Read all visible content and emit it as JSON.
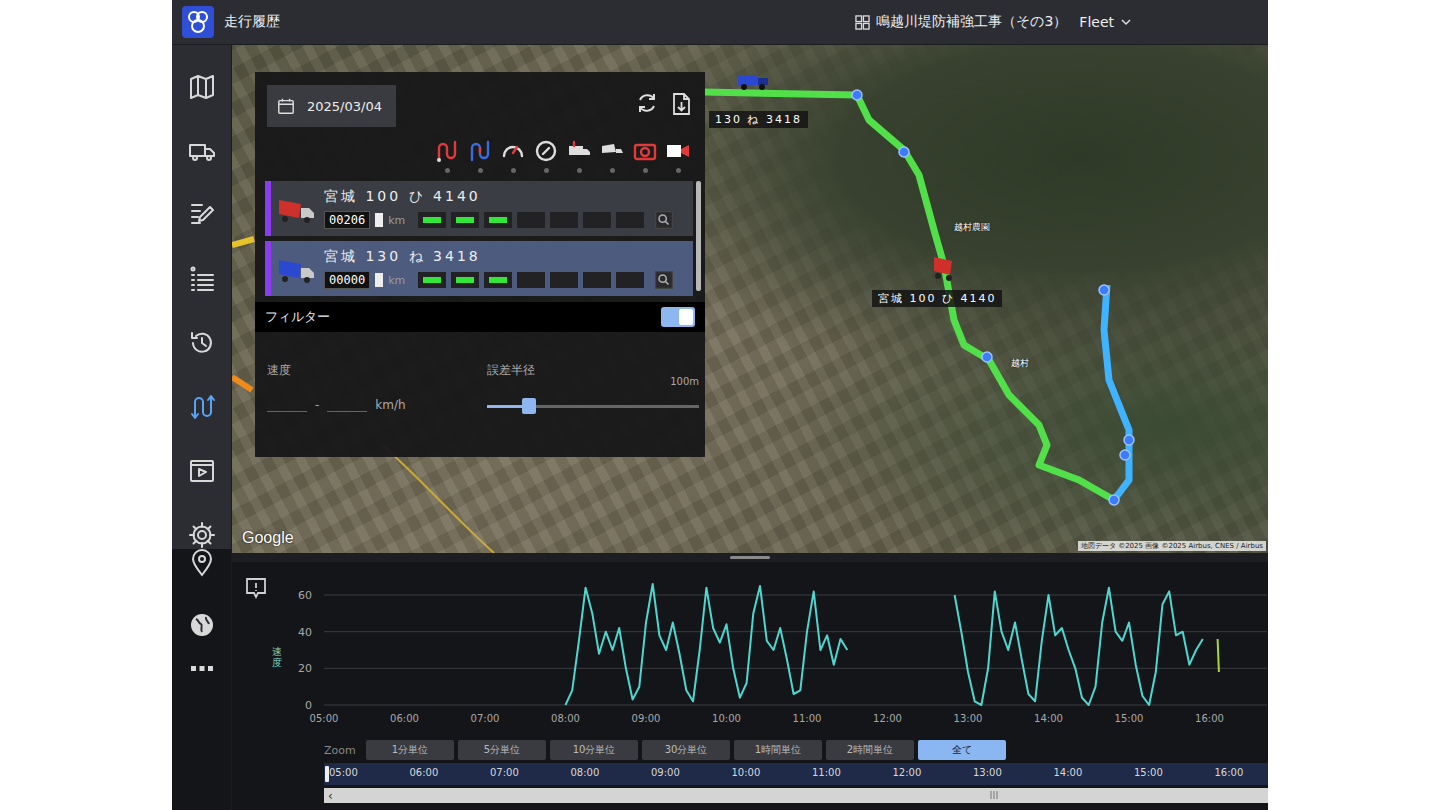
{
  "app": {
    "title": "走行履歴",
    "project": "鳴越川堤防補強工事（その3）",
    "fleet": "Fleet"
  },
  "sidebar": {
    "items": [
      {
        "kind": "map",
        "selected": false
      },
      {
        "kind": "truck",
        "selected": false
      },
      {
        "kind": "edit",
        "selected": false
      },
      {
        "kind": "list",
        "selected": false
      },
      {
        "kind": "history",
        "selected": false
      },
      {
        "kind": "route",
        "selected": true
      },
      {
        "kind": "video",
        "selected": false
      },
      {
        "kind": "gear",
        "selected": false
      }
    ],
    "bottom_items": [
      {
        "kind": "pin",
        "selected": false
      },
      {
        "kind": "globe",
        "selected": false
      },
      {
        "kind": "more",
        "selected": false
      }
    ]
  },
  "panel": {
    "date": "2025/03/04",
    "tools": [
      {
        "kind": "route-red"
      },
      {
        "kind": "route-blue"
      },
      {
        "kind": "gauge"
      },
      {
        "kind": "compass"
      },
      {
        "kind": "truck"
      },
      {
        "kind": "dumper"
      },
      {
        "kind": "camera"
      },
      {
        "kind": "video"
      }
    ],
    "vehicles": [
      {
        "name": "宮城 100 ひ 4140",
        "odometer": "00206",
        "unit": "km",
        "color": "#8a3cf0",
        "vehicle_color": "#d0302a",
        "selected": false,
        "status": [
          true,
          true,
          true,
          false,
          false,
          false,
          false
        ]
      },
      {
        "name": "宮城 130 ね 3418",
        "odometer": "00000",
        "unit": "km",
        "color": "#8a3cf0",
        "vehicle_color": "#2a48d0",
        "selected": true,
        "status": [
          true,
          true,
          true,
          false,
          false,
          false,
          false
        ]
      }
    ],
    "filter": {
      "label": "フィルター",
      "on": true
    },
    "speed": {
      "label": "速度",
      "separator": "-",
      "unit": "km/h"
    },
    "radius": {
      "label": "誤差半径",
      "max": "100m",
      "level": 0.2
    }
  },
  "map": {
    "vehicle_labels": [
      {
        "text": "130 ね 3418"
      },
      {
        "text": "宮城 100 ひ 4140"
      }
    ],
    "places": [
      "越村農園",
      "越村"
    ],
    "google": "Google",
    "attribution": "地図データ ©2025 画像 ©2025 Airbus, CNES / Airbus"
  },
  "chart": {
    "y_label": "速度",
    "y_ticks": [
      "60",
      "40",
      "20",
      "0"
    ],
    "x_ticks": [
      "05:00",
      "06:00",
      "07:00",
      "08:00",
      "09:00",
      "10:00",
      "11:00",
      "12:00",
      "13:00",
      "14:00",
      "15:00",
      "16:00"
    ],
    "series": [
      {
        "color": "#4fd6cf",
        "segments": [
          {
            "start": 8.0,
            "step_min": 5,
            "values": [
              0,
              8,
              35,
              64,
              50,
              28,
              40,
              30,
              42,
              20,
              3,
              10,
              45,
              66,
              38,
              30,
              45,
              28,
              8,
              2,
              30,
              64,
              42,
              34,
              44,
              20,
              4,
              12,
              50,
              65,
              35,
              30,
              42,
              25,
              6,
              8,
              40,
              62,
              30,
              38,
              22,
              36,
              30
            ]
          },
          {
            "start": 12.8333,
            "step_min": 5,
            "values": [
              60,
              40,
              18,
              2,
              0,
              20,
              62,
              40,
              30,
              45,
              25,
              6,
              2,
              35,
              60,
              38,
              42,
              30,
              20,
              4,
              0,
              10,
              45,
              64,
              40,
              35,
              45,
              22,
              5,
              0,
              18,
              55,
              62,
              38,
              40,
              22,
              30,
              36
            ]
          }
        ]
      },
      {
        "color": "#a8d83a",
        "segments": [
          {
            "start": 16.1,
            "step_min": 1,
            "values": [
              36,
              18
            ]
          }
        ]
      }
    ]
  },
  "zoom": {
    "label": "Zoom",
    "buttons": [
      {
        "label": "1分単位",
        "selected": false
      },
      {
        "label": "5分単位",
        "selected": false
      },
      {
        "label": "10分単位",
        "selected": false
      },
      {
        "label": "30分単位",
        "selected": false
      },
      {
        "label": "1時間単位",
        "selected": false
      },
      {
        "label": "2時間単位",
        "selected": false
      },
      {
        "label": "全て",
        "selected": true
      }
    ]
  },
  "timeline": {
    "ticks": [
      "05:00",
      "06:00",
      "07:00",
      "08:00",
      "09:00",
      "10:00",
      "11:00",
      "12:00",
      "13:00",
      "14:00",
      "15:00",
      "16:00"
    ]
  },
  "scrollbar": {
    "left_arrow": "‹"
  }
}
